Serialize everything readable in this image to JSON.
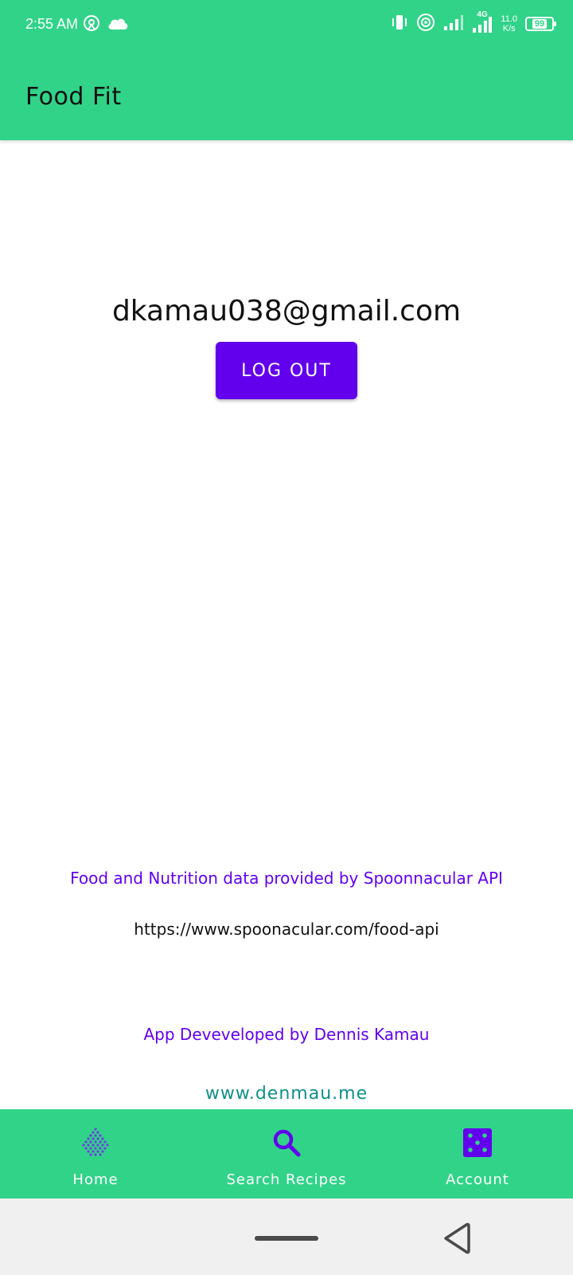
{
  "status_bar": {
    "time": "2:55 AM",
    "net_speed_value": "11.0",
    "net_speed_unit": "K/s",
    "network_type": "4G",
    "battery": "99",
    "icons": [
      "hotspot-icon",
      "cloud-icon",
      "vibrate-icon",
      "wifi-icon",
      "signal-icon",
      "signal-4g-icon",
      "battery-icon"
    ]
  },
  "app_bar": {
    "title": "Food Fit"
  },
  "account": {
    "email": "dkamau038@gmail.com",
    "logout_label": "LOG OUT"
  },
  "credits": {
    "data_credit": "Food and Nutrition data provided by Spoonnacular API",
    "api_url": "https://www.spoonacular.com/food-api",
    "developer": "App Deveveloped by Dennis Kamau",
    "website": "www.denmau.me"
  },
  "bottom_nav": {
    "items": [
      {
        "label": "Home",
        "icon": "dots-icon"
      },
      {
        "label": "Search Recipes",
        "icon": "search-icon"
      },
      {
        "label": "Account",
        "icon": "dice-icon"
      }
    ]
  },
  "colors": {
    "primary": "#31d389",
    "accent": "#6200ee",
    "link": "#0f8f8a",
    "system_nav": "#f0f0f0"
  }
}
